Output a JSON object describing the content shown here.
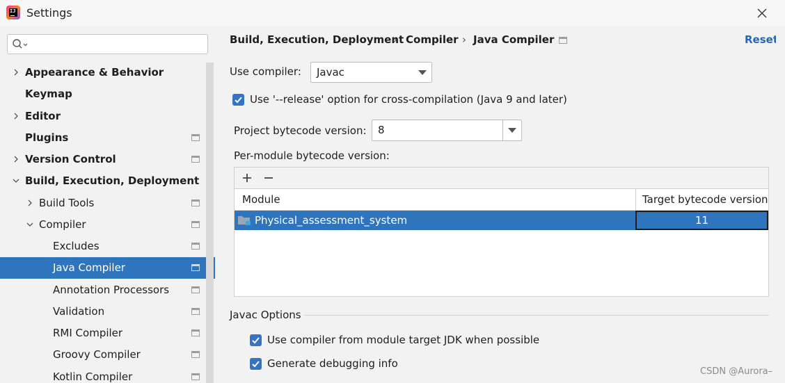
{
  "window": {
    "title": "Settings"
  },
  "search": {
    "placeholder": ""
  },
  "sidebar": {
    "items": [
      {
        "label": "Appearance & Behavior",
        "expandable": true,
        "expanded": false,
        "bold": true
      },
      {
        "label": "Keymap",
        "expandable": false,
        "bold": true
      },
      {
        "label": "Editor",
        "expandable": true,
        "expanded": false,
        "bold": true
      },
      {
        "label": "Plugins",
        "expandable": false,
        "bold": true
      },
      {
        "label": "Version Control",
        "expandable": true,
        "expanded": false,
        "bold": true
      },
      {
        "label": "Build, Execution, Deployment",
        "expandable": true,
        "expanded": true,
        "bold": true
      },
      {
        "label": "Build Tools",
        "expandable": true,
        "expanded": false
      },
      {
        "label": "Compiler",
        "expandable": true,
        "expanded": true
      },
      {
        "label": "Excludes"
      },
      {
        "label": "Java Compiler",
        "selected": true
      },
      {
        "label": "Annotation Processors"
      },
      {
        "label": "Validation"
      },
      {
        "label": "RMI Compiler"
      },
      {
        "label": "Groovy Compiler"
      },
      {
        "label": "Kotlin Compiler"
      }
    ]
  },
  "breadcrumb": {
    "parts": [
      "Build, Execution, Deployment",
      "Compiler",
      "Java Compiler"
    ],
    "separator": "›"
  },
  "reset_label": "Reset",
  "use_compiler": {
    "label": "Use compiler:",
    "value": "Javac"
  },
  "release_option": {
    "label": "Use '--release' option for cross-compilation (Java 9 and later)",
    "checked": true
  },
  "project_bytecode": {
    "label": "Project bytecode version:",
    "value": "8"
  },
  "per_module": {
    "label": "Per-module bytecode version:",
    "add_symbol": "+",
    "remove_symbol": "−",
    "columns": [
      "Module",
      "Target bytecode version"
    ],
    "rows": [
      {
        "module": "Physical_assessment_system",
        "target": "11"
      }
    ]
  },
  "javac_options": {
    "title": "Javac Options",
    "options": [
      {
        "label": "Use compiler from module target JDK when possible",
        "checked": true
      },
      {
        "label": "Generate debugging info",
        "checked": true
      }
    ]
  },
  "watermark": "CSDN @Aurora–",
  "colors": {
    "selection": "#2f75bd",
    "checkbox": "#3574c4",
    "link": "#2468b4"
  }
}
